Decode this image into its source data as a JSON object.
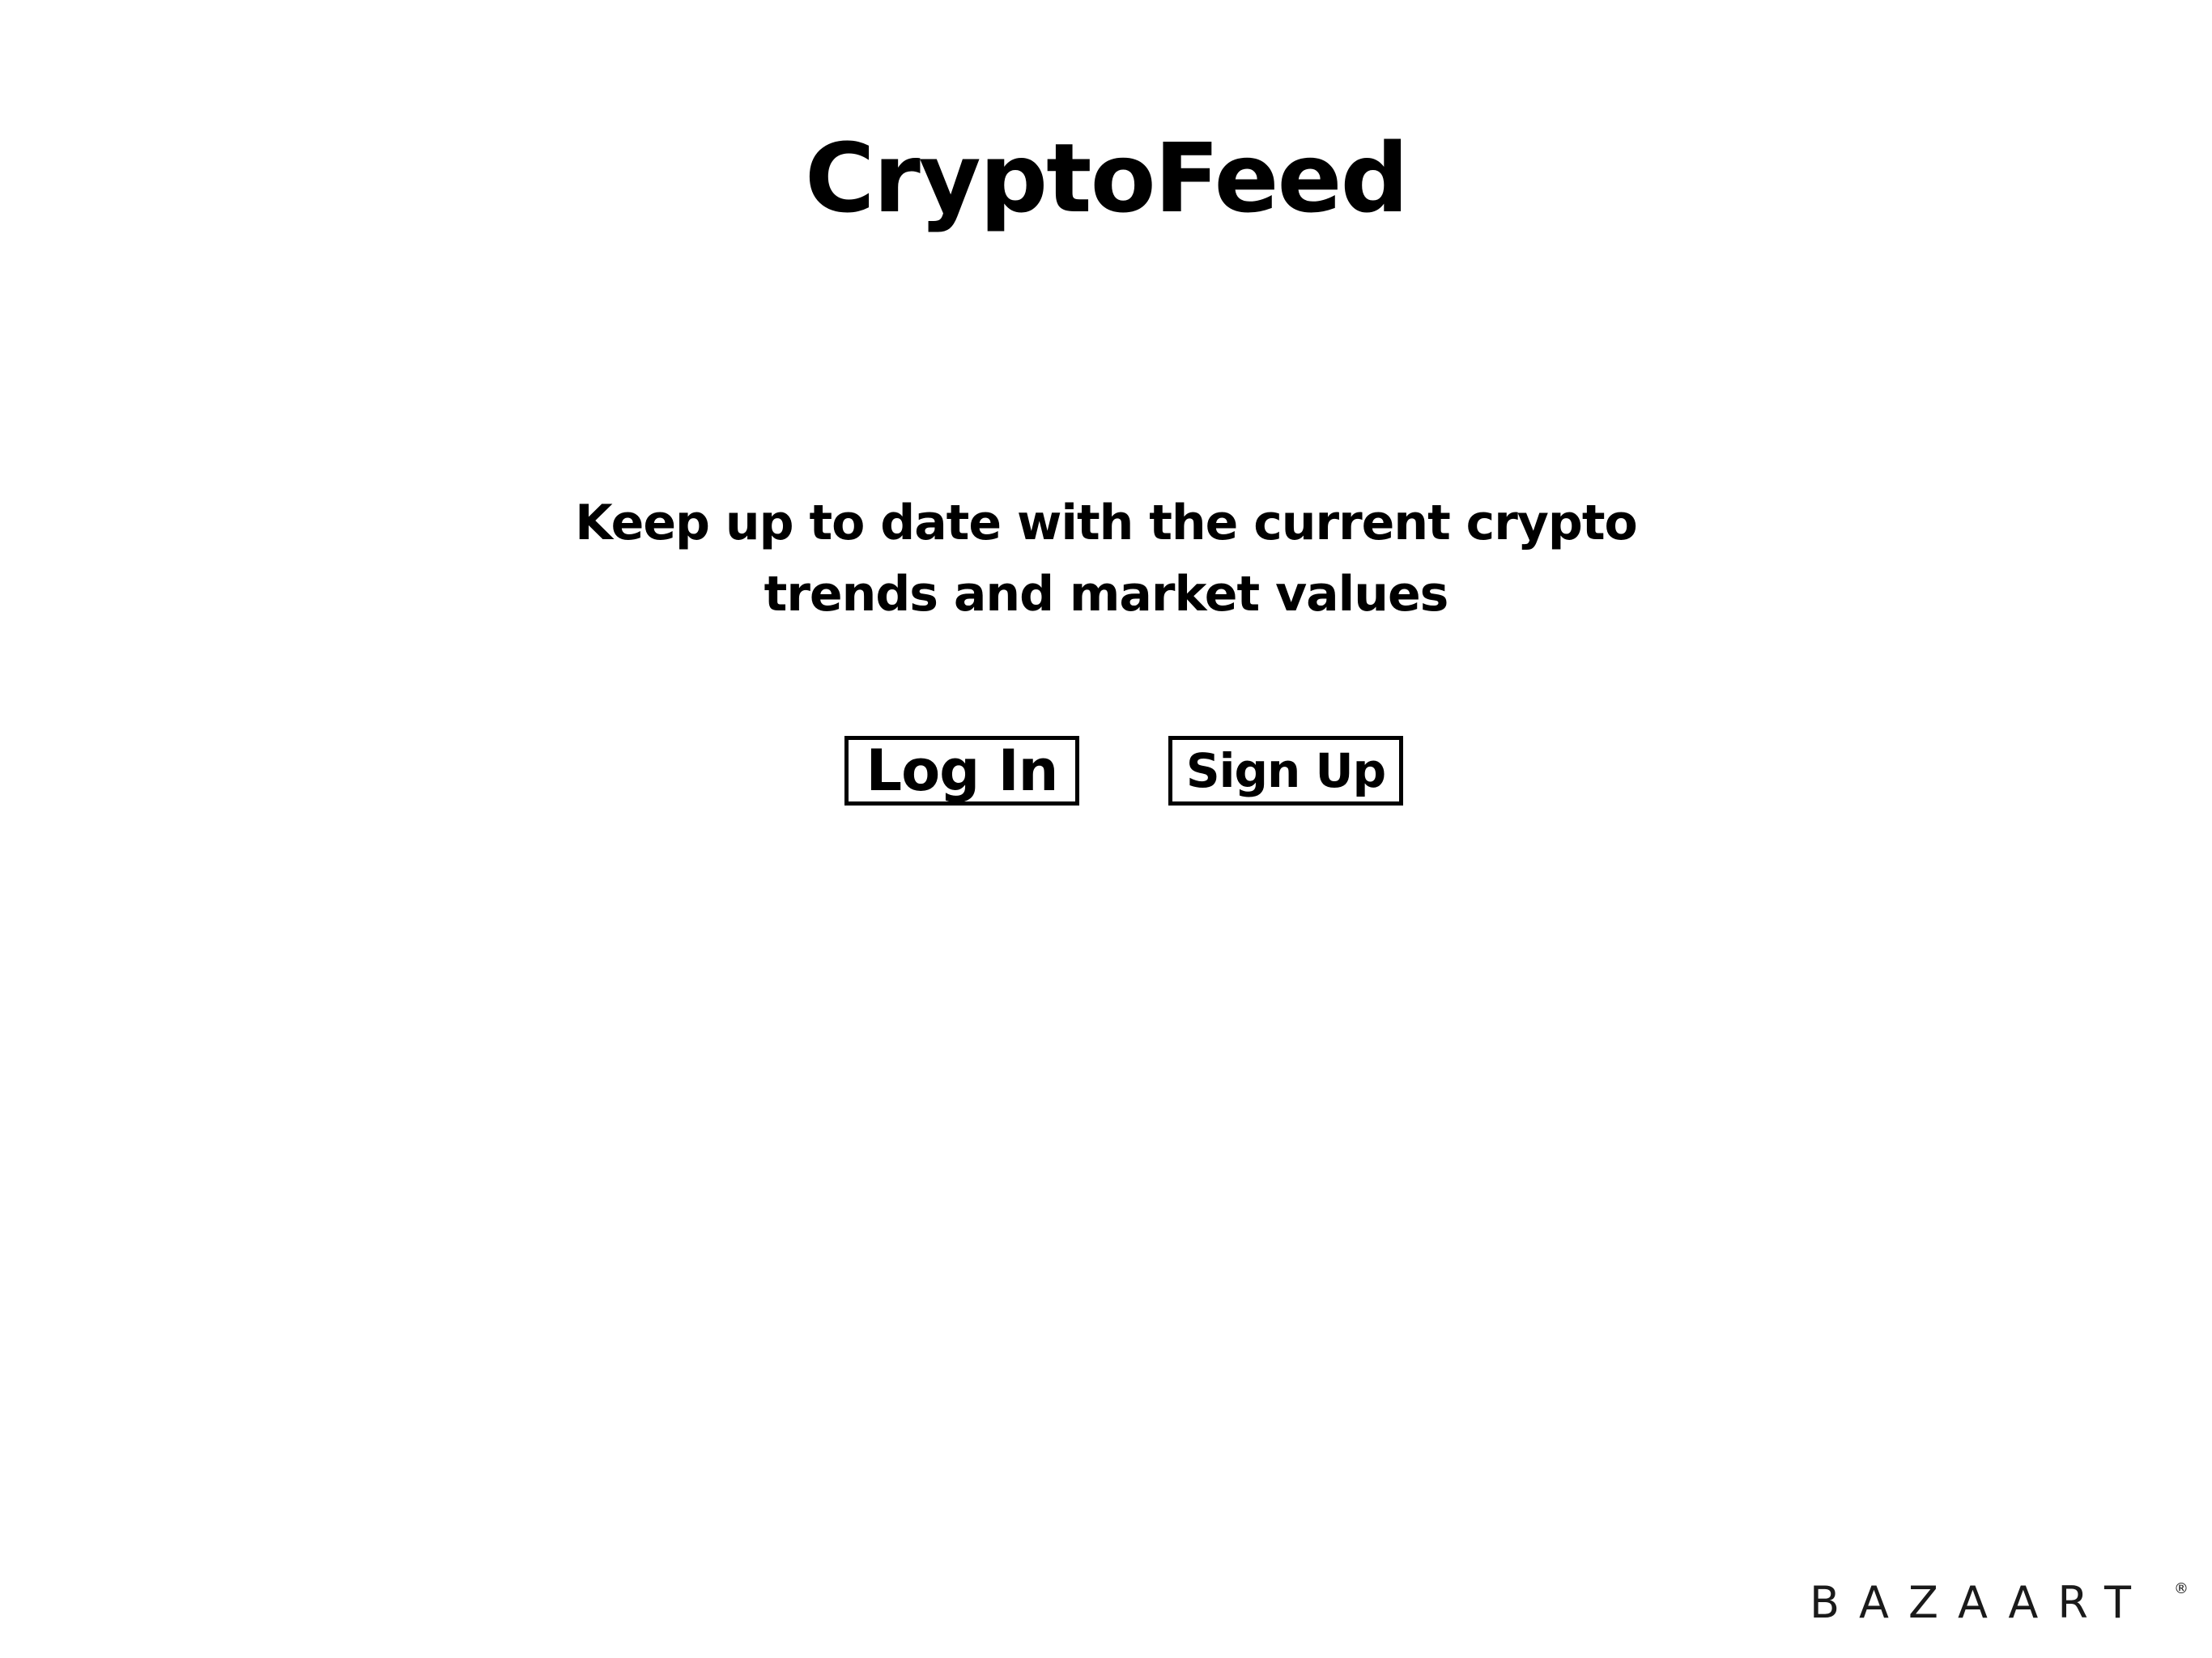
{
  "app": {
    "title": "CryptoFeed"
  },
  "hero": {
    "tagline_line1": "Keep up to date with the current crypto",
    "tagline_line2": "trends and market values"
  },
  "auth": {
    "login_label": "Log In",
    "signup_label": "Sign Up"
  },
  "watermark": {
    "text": "BAZAART",
    "mark": "®"
  },
  "colors": {
    "background": "#ffffff",
    "text": "#000000"
  }
}
